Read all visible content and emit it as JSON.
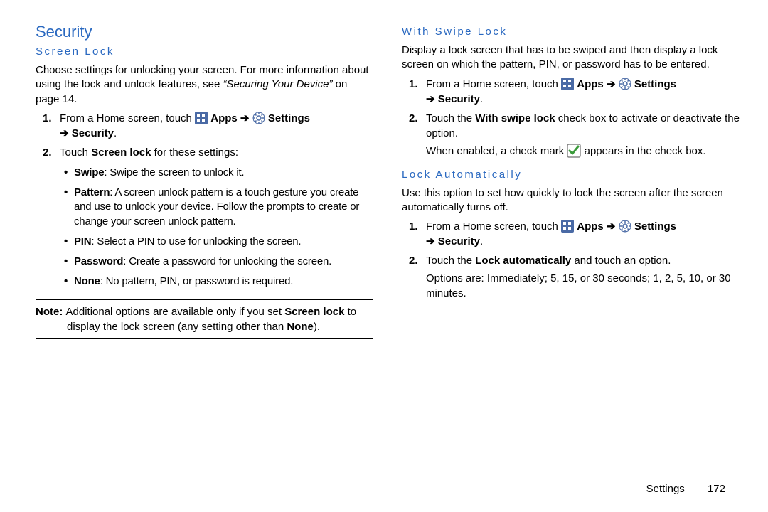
{
  "left": {
    "h1": "Security",
    "h2": "Screen Lock",
    "intro1": "Choose settings for unlocking your screen. For more information about using the lock and unlock features, see ",
    "introItalic": "“Securing Your Device”",
    "introPage": " on page 14.",
    "step1_a": "From a Home screen, touch ",
    "apps": "Apps",
    "arrow": " ➔ ",
    "settings": "Settings",
    "step1_b": "Security",
    "step2_a": "Touch ",
    "step2_b": "Screen lock",
    "step2_c": " for these settings:",
    "bullets": {
      "swipe_b": "Swipe",
      "swipe_t": ": Swipe the screen to unlock it.",
      "pattern_b": "Pattern",
      "pattern_t": ": A screen unlock pattern is a touch gesture you create and use to unlock your device. Follow the prompts to create or change your screen unlock pattern.",
      "pin_b": "PIN",
      "pin_t": ": Select a PIN to use for unlocking the screen.",
      "pw_b": "Password",
      "pw_t": ": Create a password for unlocking the screen.",
      "none_b": "None",
      "none_t": ": No pattern, PIN, or password is required."
    },
    "note_label": "Note: ",
    "note_1": "Additional options are available only if you set ",
    "note_b1": "Screen lock",
    "note_2": " to display the lock screen (any setting other than ",
    "note_b2": "None",
    "note_3": ")."
  },
  "right": {
    "h2a": "With Swipe Lock",
    "p1": "Display a lock screen that has to be swiped and then display a lock screen on which the pattern, PIN, or password has to be entered.",
    "step1_a": "From a Home screen, touch ",
    "apps": "Apps",
    "arrow": " ➔ ",
    "settings": "Settings",
    "step1_b": "Security",
    "step2_a": "Touch the ",
    "step2_b": "With swipe lock",
    "step2_c": " check box to activate or deactivate the option.",
    "cont1": "When enabled, a check mark ",
    "cont2": " appears in the check box.",
    "h2b": "Lock Automatically",
    "p2": "Use this option to set how quickly to lock the screen after the screen automatically turns off.",
    "b_step1_a": "From a Home screen, touch ",
    "b_step2_a": "Touch the ",
    "b_step2_b": "Lock automatically",
    "b_step2_c": " and touch an option.",
    "b_cont": "Options are: Immediately; 5, 15, or 30 seconds; 1, 2, 5, 10, or 30 minutes."
  },
  "footer": {
    "section": "Settings",
    "page": "172"
  }
}
